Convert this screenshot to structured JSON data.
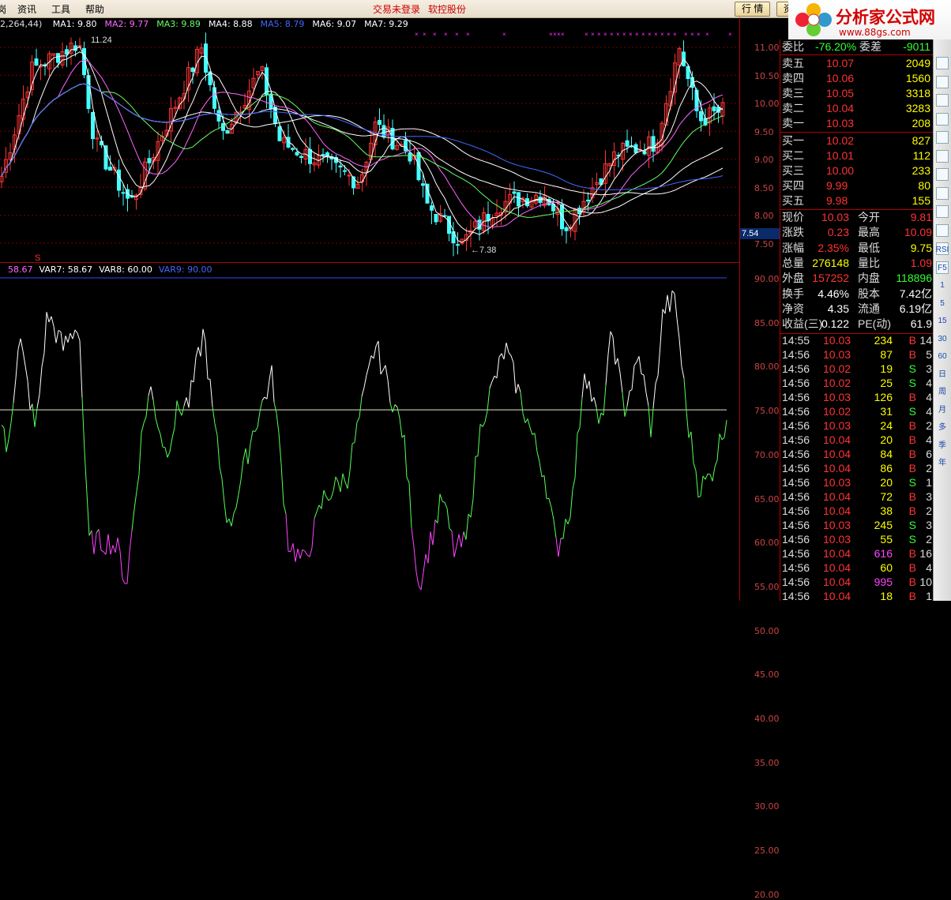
{
  "menu": {
    "items": [
      "资讯",
      "工具",
      "帮助"
    ],
    "left_fragment": "岗"
  },
  "status": {
    "trade": "交易未登录",
    "account": "软控股份"
  },
  "tabs": {
    "quote": "行 情",
    "next": "资"
  },
  "logo": {
    "title": "分析家公式网",
    "url": "www.88gs.com"
  },
  "main_legend": {
    "params": "2,264,44)",
    "items": [
      {
        "label": "MA1: 9.80",
        "color": "#ffffff"
      },
      {
        "label": "MA2: 9.77",
        "color": "#ff66ff"
      },
      {
        "label": "MA3: 9.89",
        "color": "#66ff66"
      },
      {
        "label": "MA4: 8.88",
        "color": "#ffffff"
      },
      {
        "label": "MA5: 8.79",
        "color": "#4466ff"
      },
      {
        "label": "MA6: 9.07",
        "color": "#ffffff"
      },
      {
        "label": "MA7: 9.29",
        "color": "#ffffff"
      }
    ]
  },
  "annotations": {
    "high": "11.24",
    "low": "7.38",
    "signal": "S"
  },
  "ind_legend": {
    "items": [
      {
        "label": "58.67",
        "color": "#ff66ff"
      },
      {
        "label": "VAR7: 58.67",
        "color": "#ffffff"
      },
      {
        "label": "VAR8: 60.00",
        "color": "#ffffff"
      },
      {
        "label": "VAR9: 90.00",
        "color": "#4466ff"
      }
    ]
  },
  "price_axis": [
    "11.00",
    "10.50",
    "10.00",
    "9.50",
    "9.00",
    "8.50",
    "8.00",
    "7.50"
  ],
  "current_price_tag": "7.54",
  "ind_axis": [
    "90.00",
    "85.00",
    "80.00",
    "75.00",
    "70.00",
    "65.00",
    "60.00",
    "55.00",
    "50.00",
    "45.00",
    "40.00",
    "35.00",
    "30.00",
    "25.00",
    "20.00"
  ],
  "weibi": {
    "label": "委比",
    "value": "-76.20%",
    "label2": "委差",
    "value2": "-9011"
  },
  "asks": [
    {
      "label": "卖五",
      "price": "10.07",
      "vol": "2049"
    },
    {
      "label": "卖四",
      "price": "10.06",
      "vol": "1560"
    },
    {
      "label": "卖三",
      "price": "10.05",
      "vol": "3318"
    },
    {
      "label": "卖二",
      "price": "10.04",
      "vol": "3283"
    },
    {
      "label": "卖一",
      "price": "10.03",
      "vol": "208"
    }
  ],
  "bids": [
    {
      "label": "买一",
      "price": "10.02",
      "vol": "827"
    },
    {
      "label": "买二",
      "price": "10.01",
      "vol": "112"
    },
    {
      "label": "买三",
      "price": "10.00",
      "vol": "233"
    },
    {
      "label": "买四",
      "price": "9.99",
      "vol": "80"
    },
    {
      "label": "买五",
      "price": "9.98",
      "vol": "155"
    }
  ],
  "stats": [
    {
      "l1": "现价",
      "v1": "10.03",
      "c1": "#ff3333",
      "l2": "今开",
      "v2": "9.81",
      "c2": "#ff3333"
    },
    {
      "l1": "涨跌",
      "v1": "0.23",
      "c1": "#ff3333",
      "l2": "最高",
      "v2": "10.09",
      "c2": "#ff3333"
    },
    {
      "l1": "涨幅",
      "v1": "2.35%",
      "c1": "#ff3333",
      "l2": "最低",
      "v2": "9.75",
      "c2": "#ffff00"
    },
    {
      "l1": "总量",
      "v1": "276148",
      "c1": "#ffff00",
      "l2": "量比",
      "v2": "1.09",
      "c2": "#ff3333"
    },
    {
      "l1": "外盘",
      "v1": "157252",
      "c1": "#ff3333",
      "l2": "内盘",
      "v2": "118896",
      "c2": "#33ff33"
    },
    {
      "l1": "换手",
      "v1": "4.46%",
      "c1": "#ffffff",
      "l2": "股本",
      "v2": "7.42亿",
      "c2": "#ffffff"
    },
    {
      "l1": "净资",
      "v1": "4.35",
      "c1": "#ffffff",
      "l2": "流通",
      "v2": "6.19亿",
      "c2": "#ffffff"
    },
    {
      "l1": "收益(三)",
      "v1": "0.122",
      "c1": "#ffffff",
      "l2": "PE(动)",
      "v2": "61.9",
      "c2": "#ffffff"
    }
  ],
  "ticks": [
    {
      "t": "14:55",
      "p": "10.03",
      "v": "234",
      "s": "B",
      "n": "14",
      "vc": "#ffff00"
    },
    {
      "t": "14:56",
      "p": "10.03",
      "v": "87",
      "s": "B",
      "n": "5",
      "vc": "#ffff00"
    },
    {
      "t": "14:56",
      "p": "10.02",
      "v": "19",
      "s": "S",
      "n": "3",
      "vc": "#ffff00"
    },
    {
      "t": "14:56",
      "p": "10.02",
      "v": "25",
      "s": "S",
      "n": "4",
      "vc": "#ffff00"
    },
    {
      "t": "14:56",
      "p": "10.03",
      "v": "126",
      "s": "B",
      "n": "4",
      "vc": "#ffff00"
    },
    {
      "t": "14:56",
      "p": "10.02",
      "v": "31",
      "s": "S",
      "n": "4",
      "vc": "#ffff00"
    },
    {
      "t": "14:56",
      "p": "10.03",
      "v": "24",
      "s": "B",
      "n": "2",
      "vc": "#ffff00"
    },
    {
      "t": "14:56",
      "p": "10.04",
      "v": "20",
      "s": "B",
      "n": "4",
      "vc": "#ffff00"
    },
    {
      "t": "14:56",
      "p": "10.04",
      "v": "84",
      "s": "B",
      "n": "6",
      "vc": "#ffff00"
    },
    {
      "t": "14:56",
      "p": "10.04",
      "v": "86",
      "s": "B",
      "n": "2",
      "vc": "#ffff00"
    },
    {
      "t": "14:56",
      "p": "10.03",
      "v": "20",
      "s": "S",
      "n": "1",
      "vc": "#ffff00"
    },
    {
      "t": "14:56",
      "p": "10.04",
      "v": "72",
      "s": "B",
      "n": "3",
      "vc": "#ffff00"
    },
    {
      "t": "14:56",
      "p": "10.04",
      "v": "38",
      "s": "B",
      "n": "2",
      "vc": "#ffff00"
    },
    {
      "t": "14:56",
      "p": "10.03",
      "v": "245",
      "s": "S",
      "n": "3",
      "vc": "#ffff00"
    },
    {
      "t": "14:56",
      "p": "10.03",
      "v": "55",
      "s": "S",
      "n": "2",
      "vc": "#ffff00"
    },
    {
      "t": "14:56",
      "p": "10.04",
      "v": "616",
      "s": "B",
      "n": "16",
      "vc": "#ff44ff"
    },
    {
      "t": "14:56",
      "p": "10.04",
      "v": "60",
      "s": "B",
      "n": "4",
      "vc": "#ffff00"
    },
    {
      "t": "14:56",
      "p": "10.04",
      "v": "995",
      "s": "B",
      "n": "10",
      "vc": "#ff44ff"
    },
    {
      "t": "14:56",
      "p": "10.04",
      "v": "18",
      "s": "B",
      "n": "1",
      "vc": "#ffff00"
    }
  ],
  "toolbar": [
    "RSI",
    "F5",
    "1",
    "5",
    "15",
    "30",
    "60",
    "日",
    "周",
    "月",
    "多",
    "季",
    "年"
  ]
}
